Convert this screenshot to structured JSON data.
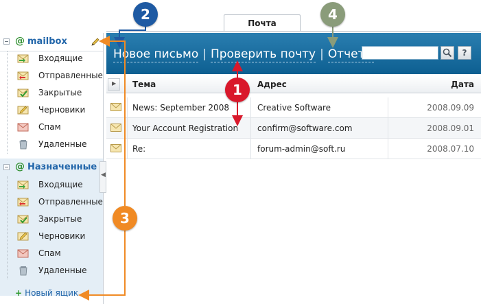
{
  "tabs": {
    "active": "Почта"
  },
  "sidebar": {
    "mailbox": {
      "title": "mailbox",
      "folders": [
        {
          "label": "Входящие",
          "icon": "inbox-icon"
        },
        {
          "label": "Отправленные",
          "icon": "sent-icon"
        },
        {
          "label": "Закрытые",
          "icon": "closed-icon"
        },
        {
          "label": "Черновики",
          "icon": "drafts-icon"
        },
        {
          "label": "Спам",
          "icon": "spam-icon"
        },
        {
          "label": "Удаленные",
          "icon": "trash-icon"
        }
      ]
    },
    "assigned": {
      "title": "Назначенные",
      "folders": [
        {
          "label": "Входящие",
          "icon": "inbox-icon"
        },
        {
          "label": "Отправленные",
          "icon": "sent-icon"
        },
        {
          "label": "Закрытые",
          "icon": "closed-icon"
        },
        {
          "label": "Черновики",
          "icon": "drafts-icon"
        },
        {
          "label": "Спам",
          "icon": "spam-icon"
        },
        {
          "label": "Удаленные",
          "icon": "trash-icon"
        }
      ]
    },
    "new_box": "Новый ящик"
  },
  "toolbar": {
    "new_message": "Новое письмо",
    "check_mail": "Проверить почту",
    "reports": "Отчеты",
    "separator": "|",
    "search_value": "",
    "search_icon": "magnifier-icon",
    "help_label": "?"
  },
  "table": {
    "columns": [
      "Тема",
      "Адрес",
      "Дата"
    ],
    "rows": [
      {
        "subject": "News: September 2008",
        "address": "Creative Software",
        "date": "2008.09.09"
      },
      {
        "subject": "Your Account Registration",
        "address": "confirm@software.com",
        "date": "2008.09.01"
      },
      {
        "subject": "Re:",
        "address": "forum-admin@soft.ru",
        "date": "2008.07.10"
      }
    ]
  },
  "annotations": {
    "one": "1",
    "two": "2",
    "three": "3",
    "four": "4"
  },
  "colors": {
    "toolbar": "#0d5f91",
    "badge1": "#d9182b",
    "badge2": "#1e5aa3",
    "badge3": "#f08a24",
    "badge4": "#8a9c7a"
  }
}
